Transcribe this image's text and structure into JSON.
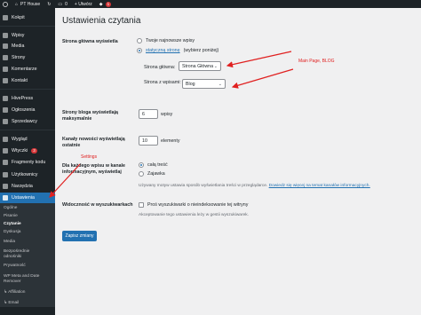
{
  "adminbar": {
    "site_name": "PT House",
    "comments_count": "0",
    "new_label": "+ Utwórz",
    "updates_count": "1"
  },
  "sidebar": {
    "items": [
      {
        "label": "Kokpit"
      },
      {
        "label": "Wpisy"
      },
      {
        "label": "Media"
      },
      {
        "label": "Strony"
      },
      {
        "label": "Komentarze"
      },
      {
        "label": "Kontakt"
      },
      {
        "label": "HivePress"
      },
      {
        "label": "Ogłoszenia"
      },
      {
        "label": "Sprzedawcy"
      },
      {
        "label": "Wygląd"
      },
      {
        "label": "Wtyczki",
        "badge": "3"
      },
      {
        "label": "Fragmenty kodu"
      },
      {
        "label": "Użytkownicy"
      },
      {
        "label": "Narzędzia"
      },
      {
        "label": "Ustawienia"
      }
    ],
    "submenu": [
      {
        "label": "Ogólne"
      },
      {
        "label": "Pisanie"
      },
      {
        "label": "Czytanie"
      },
      {
        "label": "Dyskusja"
      },
      {
        "label": "Media"
      },
      {
        "label": "Bezpośrednie"
      },
      {
        "label": "odnośniki"
      },
      {
        "label": "Prywatność"
      },
      {
        "label": "WP Meta and Date"
      },
      {
        "label": "Remover"
      },
      {
        "label": "↳ Affiliation"
      },
      {
        "label": "↳ Email"
      }
    ]
  },
  "page": {
    "title": "Ustawienia czytania",
    "homepage": {
      "label": "Strona główna wyświetla",
      "option_posts": "Twoje najnowsze wpisy",
      "option_static": "statyczną stronę",
      "option_static_suffix": "(wybierz poniżej)",
      "front_label": "Strona główna:",
      "front_value": "Strona Główna",
      "posts_label": "Strona z wpisami:",
      "posts_value": "Blog"
    },
    "blog_pages": {
      "label_line1": "Strony bloga wyświetlają",
      "label_line2": "maksymalnie",
      "value": "6",
      "unit": "wpisy"
    },
    "feed_items": {
      "label_line1": "Kanały nowości wyświetlają",
      "label_line2": "ostatnie",
      "value": "10",
      "unit": "elementy"
    },
    "feed_content": {
      "label_line1": "Dla każdego wpisu w kanale",
      "label_line2": "informacyjnym, wyświetlaj",
      "option_full": "całą treść",
      "option_excerpt": "Zajawka",
      "desc_text": "Używany motyw ustawia sposób wyświetlania treści w przeglądarce.",
      "desc_link": "Dowiedz się więcej na temat kanałów informacyjnych."
    },
    "visibility": {
      "label": "Widoczność w wyszukiwarkach",
      "checkbox_label": "Proś wyszukiwarki o nieindeksowanie tej witryny",
      "desc": "Akceptowanie tego ustawienia leży w gestii wyszukiwarek."
    },
    "save_button": "Zapisz zmiany"
  },
  "annotations": {
    "main_page_blog": "Main Page, BLOG",
    "settings": "Settings"
  },
  "colors": {
    "sidebar_bg": "#1d2327",
    "accent": "#2271b1",
    "annotation": "#e02020"
  }
}
